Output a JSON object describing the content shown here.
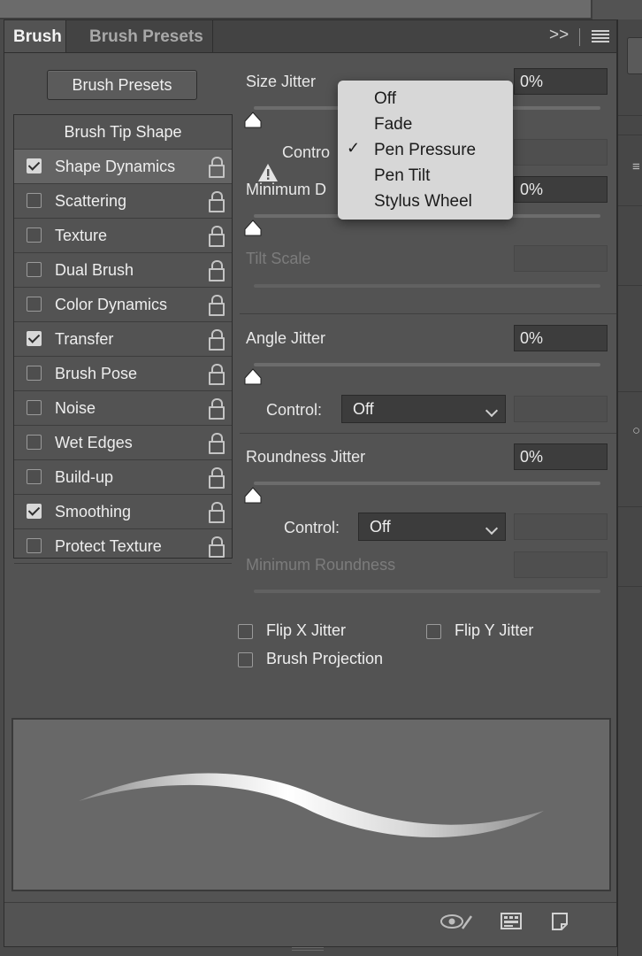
{
  "tabs": {
    "brush": "Brush",
    "presets": "Brush Presets",
    "expand": ">>",
    "menu_icon": "hamburger-icon"
  },
  "presets_button": "Brush Presets",
  "options": {
    "header": "Brush Tip Shape",
    "items": [
      {
        "label": "Shape Dynamics",
        "checked": true,
        "selected": true
      },
      {
        "label": "Scattering",
        "checked": false
      },
      {
        "label": "Texture",
        "checked": false
      },
      {
        "label": "Dual Brush",
        "checked": false
      },
      {
        "label": "Color Dynamics",
        "checked": false
      },
      {
        "label": "Transfer",
        "checked": true
      },
      {
        "label": "Brush Pose",
        "checked": false
      },
      {
        "label": "Noise",
        "checked": false
      },
      {
        "label": "Wet Edges",
        "checked": false
      },
      {
        "label": "Build-up",
        "checked": false
      },
      {
        "label": "Smoothing",
        "checked": true
      },
      {
        "label": "Protect Texture",
        "checked": false
      }
    ]
  },
  "size_jitter": {
    "label": "Size Jitter",
    "value": "0%",
    "control_label": "Contro"
  },
  "min_diameter": {
    "label": "Minimum D",
    "value": "0%"
  },
  "tilt_scale": {
    "label": "Tilt Scale",
    "value": ""
  },
  "angle_jitter": {
    "label": "Angle Jitter",
    "value": "0%",
    "control_label": "Control:",
    "control_value": "Off"
  },
  "roundness_jitter": {
    "label": "Roundness Jitter",
    "value": "0%",
    "control_label": "Control:",
    "control_value": "Off"
  },
  "min_roundness": {
    "label": "Minimum Roundness"
  },
  "checks": {
    "flip_x": "Flip X Jitter",
    "flip_y": "Flip Y Jitter",
    "projection": "Brush Projection"
  },
  "dropdown": {
    "items": [
      "Off",
      "Fade",
      "Pen Pressure",
      "Pen Tilt",
      "Stylus Wheel"
    ],
    "selected": "Pen Pressure",
    "check_glyph": "✓"
  }
}
